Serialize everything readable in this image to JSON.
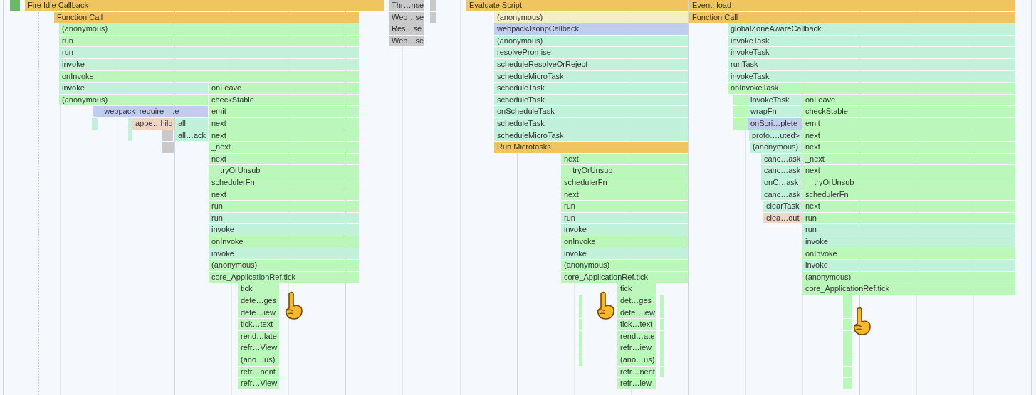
{
  "flame_chart": {
    "rows": [
      [
        {
          "label": "Fire Idle Callback",
          "color": "#f0c45e"
        },
        {
          "label": "Thr…nse",
          "color": "#c9c9c9"
        },
        {
          "label": "Evaluate Script",
          "color": "#f0c45e"
        },
        {
          "label": "Event: load",
          "color": "#f0c45e"
        }
      ],
      [
        {
          "label": "Function Call",
          "color": "#f0c45e"
        },
        {
          "label": "Web…se",
          "color": "#c9c9c9"
        },
        {
          "label": "(anonymous)",
          "color": "#f3efc2"
        },
        {
          "label": "Function Call",
          "color": "#f0c45e"
        }
      ],
      [
        {
          "label": "(anonymous)",
          "color": "#bbf7bb"
        },
        {
          "label": "Res…se",
          "color": "#c9c9c9"
        },
        {
          "label": "webpackJsonpCallback",
          "color": "#c0cdef"
        },
        {
          "label": "globalZoneAwareCallback",
          "color": "#c2f1d9"
        }
      ],
      [
        {
          "label": "run",
          "color": "#bbf7bb"
        },
        {
          "label": "Web…se",
          "color": "#c9c9c9"
        },
        {
          "label": "(anonymous)",
          "color": "#c2f1d9"
        },
        {
          "label": "invokeTask",
          "color": "#c2f1d9"
        }
      ],
      [
        {
          "label": "run",
          "color": "#c2f1d9"
        },
        {
          "label": "resolvePromise",
          "color": "#c2f1d9"
        },
        {
          "label": "invokeTask",
          "color": "#c2f1d9"
        }
      ],
      [
        {
          "label": "invoke",
          "color": "#c2f1d9"
        },
        {
          "label": "scheduleResolveOrReject",
          "color": "#c2f1d9"
        },
        {
          "label": "runTask",
          "color": "#c2f1d9"
        }
      ],
      [
        {
          "label": "onInvoke",
          "color": "#bbf7bb"
        },
        {
          "label": "scheduleMicroTask",
          "color": "#c2f1d9"
        },
        {
          "label": "invokeTask",
          "color": "#c2f1d9"
        }
      ],
      [
        {
          "label": "invoke",
          "color": "#c2f1d9"
        },
        {
          "label": "onLeave",
          "color": "#bbf7bb"
        },
        {
          "label": "scheduleTask",
          "color": "#c2f1d9"
        },
        {
          "label": "onInvokeTask",
          "color": "#bbf7bb"
        }
      ],
      [
        {
          "label": "(anonymous)",
          "color": "#bbf7bb"
        },
        {
          "label": "checkStable",
          "color": "#bbf7bb"
        },
        {
          "label": "scheduleTask",
          "color": "#c2f1d9"
        },
        {
          "label": "invokeTask",
          "color": "#c2f1d9"
        },
        {
          "label": "onLeave",
          "color": "#bbf7bb"
        }
      ],
      [
        {
          "label": "__webpack_require__.e",
          "color": "#c0cdef"
        },
        {
          "label": "emit",
          "color": "#bbf7bb"
        },
        {
          "label": "onScheduleTask",
          "color": "#c2f1d9"
        },
        {
          "label": "wrapFn",
          "color": "#c2f1d9"
        },
        {
          "label": "checkStable",
          "color": "#bbf7bb"
        }
      ],
      [
        {
          "label": "appe…hild",
          "color": "#f1d5c4"
        },
        {
          "label": "all",
          "color": "#c2f1d9"
        },
        {
          "label": "next",
          "color": "#bbf7bb"
        },
        {
          "label": "scheduleTask",
          "color": "#c2f1d9"
        },
        {
          "label": "onScri…plete",
          "color": "#c0cdef"
        },
        {
          "label": "emit",
          "color": "#bbf7bb"
        }
      ],
      [
        {
          "label": "all…ack",
          "color": "#c2f1d9"
        },
        {
          "label": "next",
          "color": "#bbf7bb"
        },
        {
          "label": "scheduleMicroTask",
          "color": "#c2f1d9"
        },
        {
          "label": "proto….uted>",
          "color": "#c2f1d9"
        },
        {
          "label": "next",
          "color": "#bbf7bb"
        }
      ],
      [
        {
          "label": "_next",
          "color": "#bbf7bb"
        },
        {
          "label": "Run Microtasks",
          "color": "#f0c45e"
        },
        {
          "label": "(anonymous)",
          "color": "#c2f1d9"
        },
        {
          "label": "next",
          "color": "#bbf7bb"
        }
      ],
      [
        {
          "label": "next",
          "color": "#bbf7bb"
        },
        {
          "label": "next",
          "color": "#bbf7bb"
        },
        {
          "label": "canc…ask",
          "color": "#c2f1d9"
        },
        {
          "label": "_next",
          "color": "#bbf7bb"
        }
      ],
      [
        {
          "label": "__tryOrUnsub",
          "color": "#bbf7bb"
        },
        {
          "label": "__tryOrUnsub",
          "color": "#bbf7bb"
        },
        {
          "label": "canc…ask",
          "color": "#c2f1d9"
        },
        {
          "label": "next",
          "color": "#bbf7bb"
        }
      ],
      [
        {
          "label": "schedulerFn",
          "color": "#bbf7bb"
        },
        {
          "label": "schedulerFn",
          "color": "#bbf7bb"
        },
        {
          "label": "onC…ask",
          "color": "#c2f1d9"
        },
        {
          "label": "__tryOrUnsub",
          "color": "#bbf7bb"
        }
      ],
      [
        {
          "label": "next",
          "color": "#bbf7bb"
        },
        {
          "label": "next",
          "color": "#bbf7bb"
        },
        {
          "label": "canc…ask",
          "color": "#c2f1d9"
        },
        {
          "label": "schedulerFn",
          "color": "#bbf7bb"
        }
      ],
      [
        {
          "label": "run",
          "color": "#bbf7bb"
        },
        {
          "label": "run",
          "color": "#bbf7bb"
        },
        {
          "label": "clearTask",
          "color": "#c2f1d9"
        },
        {
          "label": "next",
          "color": "#bbf7bb"
        }
      ],
      [
        {
          "label": "run",
          "color": "#c2f1d9"
        },
        {
          "label": "run",
          "color": "#c2f1d9"
        },
        {
          "label": "clea…out",
          "color": "#f1d5c4"
        },
        {
          "label": "run",
          "color": "#bbf7bb"
        }
      ],
      [
        {
          "label": "invoke",
          "color": "#c2f1d9"
        },
        {
          "label": "invoke",
          "color": "#c2f1d9"
        },
        {
          "label": "run",
          "color": "#c2f1d9"
        }
      ],
      [
        {
          "label": "onInvoke",
          "color": "#bbf7bb"
        },
        {
          "label": "onInvoke",
          "color": "#bbf7bb"
        },
        {
          "label": "invoke",
          "color": "#c2f1d9"
        }
      ],
      [
        {
          "label": "invoke",
          "color": "#c2f1d9"
        },
        {
          "label": "invoke",
          "color": "#c2f1d9"
        },
        {
          "label": "onInvoke",
          "color": "#bbf7bb"
        }
      ],
      [
        {
          "label": "(anonymous)",
          "color": "#bbf7bb"
        },
        {
          "label": "(anonymous)",
          "color": "#bbf7bb"
        },
        {
          "label": "invoke",
          "color": "#c2f1d9"
        }
      ],
      [
        {
          "label": "core_ApplicationRef.tick",
          "color": "#bbf7bb"
        },
        {
          "label": "core_ApplicationRef.tick",
          "color": "#bbf7bb"
        },
        {
          "label": "(anonymous)",
          "color": "#bbf7bb"
        }
      ],
      [
        {
          "label": "tick",
          "color": "#bbf7bb"
        },
        {
          "label": "tick",
          "color": "#bbf7bb"
        },
        {
          "label": "core_ApplicationRef.tick",
          "color": "#bbf7bb"
        }
      ],
      [
        {
          "label": "dete…ges",
          "color": "#bbf7bb"
        },
        {
          "label": "det…ges",
          "color": "#bbf7bb"
        }
      ],
      [
        {
          "label": "dete…iew",
          "color": "#bbf7bb"
        },
        {
          "label": "dete…iew",
          "color": "#bbf7bb"
        }
      ],
      [
        {
          "label": "tick…text",
          "color": "#bbf7bb"
        },
        {
          "label": "tick…text",
          "color": "#bbf7bb"
        }
      ],
      [
        {
          "label": "rend…late",
          "color": "#bbf7bb"
        },
        {
          "label": "rend…ate",
          "color": "#bbf7bb"
        }
      ],
      [
        {
          "label": "refr…View",
          "color": "#bbf7bb"
        },
        {
          "label": "refr…iew",
          "color": "#bbf7bb"
        }
      ],
      [
        {
          "label": "(ano…us)",
          "color": "#bbf7bb"
        },
        {
          "label": "(ano…us)",
          "color": "#bbf7bb"
        }
      ],
      [
        {
          "label": "refr…nent",
          "color": "#bbf7bb"
        },
        {
          "label": "refr…nent",
          "color": "#bbf7bb"
        }
      ],
      [
        {
          "label": "refr…View",
          "color": "#bbf7bb"
        },
        {
          "label": "refr…iew",
          "color": "#bbf7bb"
        }
      ]
    ]
  }
}
